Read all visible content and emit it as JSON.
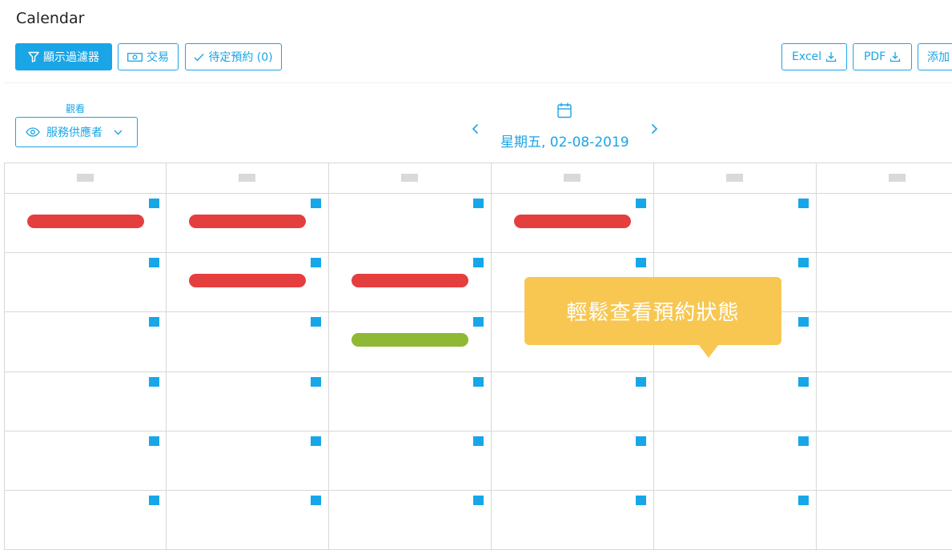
{
  "page_title": "Calendar",
  "toolbar": {
    "filter_label": "顯示過濾器",
    "transactions_label": "交易",
    "pending_label": "待定預約 (0)",
    "excel_label": "Excel",
    "pdf_label": "PDF",
    "add_label": "添加"
  },
  "view": {
    "label": "觀看",
    "selected": "服務供應者"
  },
  "date_nav": {
    "date_text": "星期五, 02-08-2019"
  },
  "calendar": {
    "columns": 6,
    "rows": 6,
    "bars": [
      {
        "row": 0,
        "col": 0,
        "status": "cancelled",
        "color": "#e53e3e"
      },
      {
        "row": 0,
        "col": 1,
        "status": "cancelled",
        "color": "#e53e3e"
      },
      {
        "row": 0,
        "col": 3,
        "status": "cancelled",
        "color": "#e53e3e"
      },
      {
        "row": 1,
        "col": 1,
        "status": "cancelled",
        "color": "#e53e3e"
      },
      {
        "row": 1,
        "col": 2,
        "status": "cancelled",
        "color": "#e53e3e"
      },
      {
        "row": 2,
        "col": 2,
        "status": "approved",
        "color": "#8fb934"
      }
    ]
  },
  "tooltip": {
    "text": "輕鬆查看預約狀態"
  },
  "colors": {
    "accent": "#1aa5e6",
    "tooltip": "#f7c752",
    "cancelled": "#e53e3e",
    "approved": "#8fb934"
  }
}
